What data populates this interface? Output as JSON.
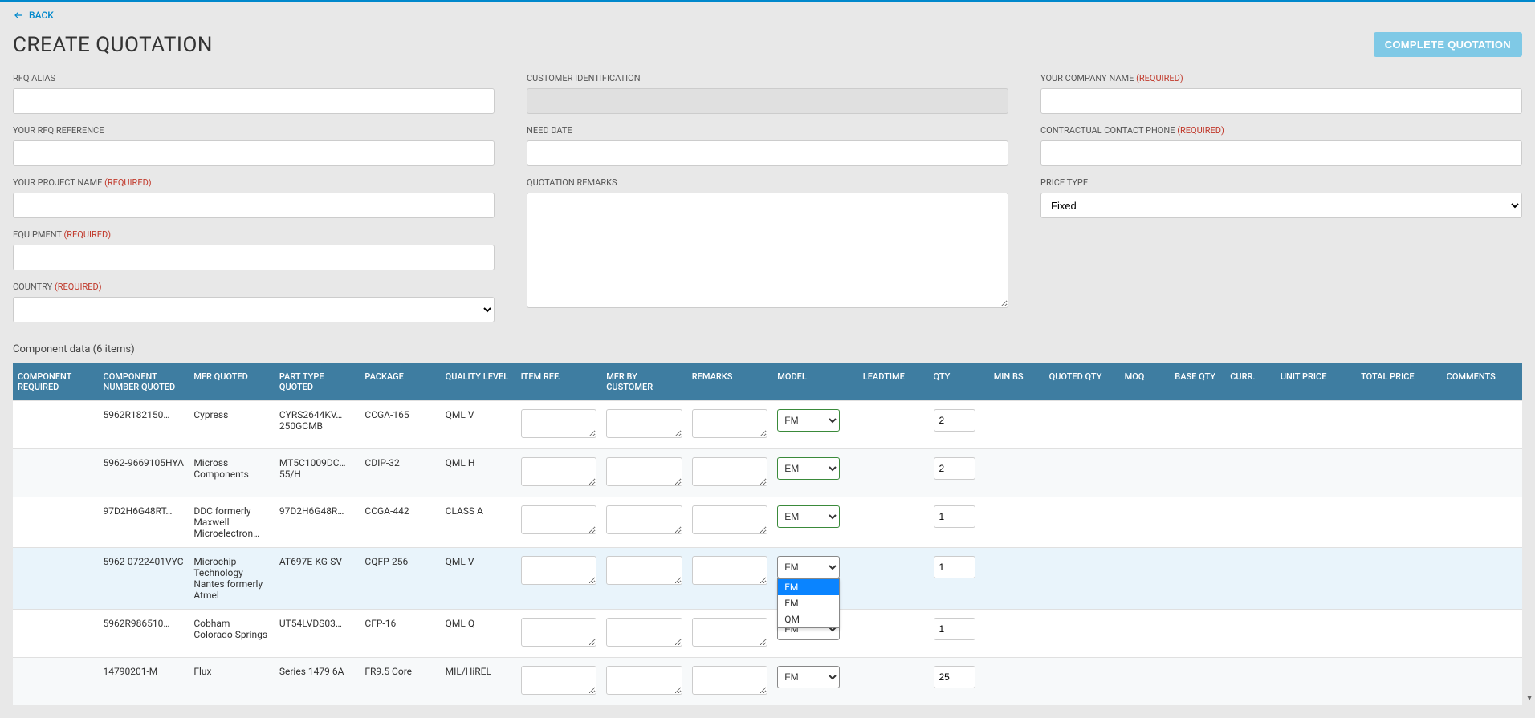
{
  "back_label": "BACK",
  "page_title": "CREATE QUOTATION",
  "complete_button": "COMPLETE QUOTATION",
  "required_label": "(Required)",
  "fields": {
    "rfq_alias": {
      "label": "RFQ ALIAS",
      "value": ""
    },
    "your_rfq_reference": {
      "label": "YOUR RFQ REFERENCE",
      "value": ""
    },
    "your_project_name": {
      "label": "YOUR PROJECT NAME",
      "value": "",
      "required": true
    },
    "equipment": {
      "label": "EQUIPMENT",
      "value": "",
      "required": true
    },
    "country": {
      "label": "COUNTRY",
      "value": "",
      "required": true
    },
    "customer_identification": {
      "label": "CUSTOMER IDENTIFICATION",
      "value": ""
    },
    "need_date": {
      "label": "NEED DATE",
      "value": ""
    },
    "quotation_remarks": {
      "label": "QUOTATION REMARKS",
      "value": ""
    },
    "your_company_name": {
      "label": "YOUR COMPANY NAME",
      "value": "",
      "required": true
    },
    "contractual_contact_phone": {
      "label": "CONTRACTUAL CONTACT PHONE",
      "value": "",
      "required": true
    },
    "price_type": {
      "label": "PRICE TYPE",
      "value": "Fixed"
    }
  },
  "component_data_label": "Component data (6 items)",
  "table": {
    "headers": [
      "COMPONENT REQUIRED",
      "COMPONENT NUMBER QUOTED",
      "MFR QUOTED",
      "PART TYPE QUOTED",
      "PACKAGE",
      "QUALITY LEVEL",
      "ITEM REF.",
      "MFR BY CUSTOMER",
      "REMARKS",
      "MODEL",
      "LEADTIME",
      "QTY",
      "MIN BS",
      "QUOTED QTY",
      "MOQ",
      "BASE QTY",
      "CURR.",
      "UNIT PRICE",
      "TOTAL PRICE",
      "COMMENTS"
    ],
    "rows": [
      {
        "component_number": "5962R182150…",
        "mfr": "Cypress",
        "part_type": "CYRS2644KV… 250GCMB",
        "package": "CCGA-165",
        "quality": "QML V",
        "model": "FM",
        "qty": "2"
      },
      {
        "component_number": "5962-9669105HYA",
        "mfr": "Micross Components",
        "part_type": "MT5C1009DC… 55/H",
        "package": "CDIP-32",
        "quality": "QML H",
        "model": "EM",
        "qty": "2"
      },
      {
        "component_number": "97D2H6G48RT…",
        "mfr": "DDC formerly Maxwell Microelectron…",
        "part_type": "97D2H6G48R…",
        "package": "CCGA-442",
        "quality": "CLASS A",
        "model": "EM",
        "qty": "1"
      },
      {
        "component_number": "5962-0722401VYC",
        "mfr": "Microchip Technology Nantes formerly Atmel",
        "part_type": "AT697E-KG-SV",
        "package": "CQFP-256",
        "quality": "QML V",
        "model": "FM",
        "qty": "1",
        "dropdown_open": true
      },
      {
        "component_number": "5962R986510…",
        "mfr": "Cobham Colorado Springs",
        "part_type": "UT54LVDS03…",
        "package": "CFP-16",
        "quality": "QML Q",
        "model": "FM",
        "qty": "1"
      },
      {
        "component_number": "14790201-M",
        "mfr": "Flux",
        "part_type": "Series 1479 6A",
        "package": "FR9.5 Core",
        "quality": "MIL/HiREL",
        "model": "FM",
        "qty": "25"
      }
    ],
    "model_options": [
      "FM",
      "EM",
      "QM"
    ]
  }
}
